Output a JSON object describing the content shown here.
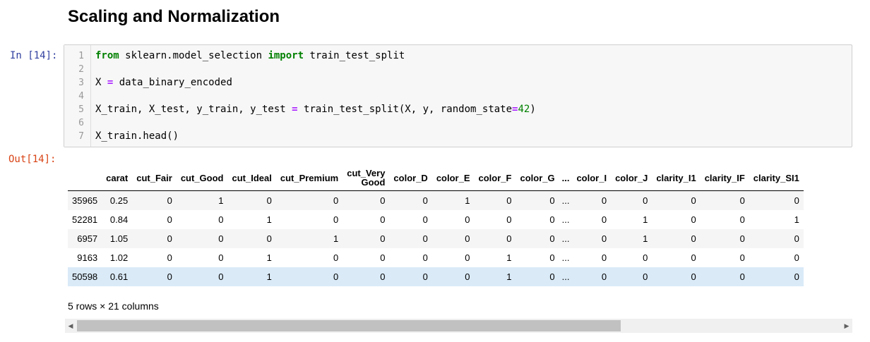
{
  "heading": "Scaling and Normalization",
  "in_prompt": "In [14]:",
  "out_prompt": "Out[14]:",
  "code_lines": [
    {
      "n": "1",
      "tokens": [
        {
          "t": "kw",
          "v": "from"
        },
        {
          "t": "",
          "v": " sklearn.model_selection "
        },
        {
          "t": "kw",
          "v": "import"
        },
        {
          "t": "",
          "v": " train_test_split"
        }
      ]
    },
    {
      "n": "2",
      "tokens": []
    },
    {
      "n": "3",
      "tokens": [
        {
          "t": "",
          "v": "X "
        },
        {
          "t": "op",
          "v": "="
        },
        {
          "t": "",
          "v": " data_binary_encoded"
        }
      ]
    },
    {
      "n": "4",
      "tokens": []
    },
    {
      "n": "5",
      "tokens": [
        {
          "t": "",
          "v": "X_train, X_test, y_train, y_test "
        },
        {
          "t": "op",
          "v": "="
        },
        {
          "t": "",
          "v": " train_test_split(X, y, random_state"
        },
        {
          "t": "op",
          "v": "="
        },
        {
          "t": "num",
          "v": "42"
        },
        {
          "t": "",
          "v": ")"
        }
      ]
    },
    {
      "n": "6",
      "tokens": []
    },
    {
      "n": "7",
      "tokens": [
        {
          "t": "",
          "v": "X_train.head()"
        }
      ]
    }
  ],
  "table": {
    "columns": [
      "carat",
      "cut_Fair",
      "cut_Good",
      "cut_Ideal",
      "cut_Premium",
      "cut_Very Good",
      "color_D",
      "color_E",
      "color_F",
      "color_G",
      "...",
      "color_I",
      "color_J",
      "clarity_I1",
      "clarity_IF",
      "clarity_SI1"
    ],
    "rows": [
      {
        "index": "35965",
        "cells": [
          "0.25",
          "0",
          "1",
          "0",
          "0",
          "0",
          "0",
          "1",
          "0",
          "0",
          "...",
          "0",
          "0",
          "0",
          "0",
          "0"
        ]
      },
      {
        "index": "52281",
        "cells": [
          "0.84",
          "0",
          "0",
          "1",
          "0",
          "0",
          "0",
          "0",
          "0",
          "0",
          "...",
          "0",
          "1",
          "0",
          "0",
          "1"
        ]
      },
      {
        "index": "6957",
        "cells": [
          "1.05",
          "0",
          "0",
          "0",
          "1",
          "0",
          "0",
          "0",
          "0",
          "0",
          "...",
          "0",
          "1",
          "0",
          "0",
          "0"
        ]
      },
      {
        "index": "9163",
        "cells": [
          "1.02",
          "0",
          "0",
          "1",
          "0",
          "0",
          "0",
          "0",
          "1",
          "0",
          "...",
          "0",
          "0",
          "0",
          "0",
          "0"
        ]
      },
      {
        "index": "50598",
        "cells": [
          "0.61",
          "0",
          "0",
          "1",
          "0",
          "0",
          "0",
          "0",
          "1",
          "0",
          "...",
          "0",
          "0",
          "0",
          "0",
          "0"
        ]
      }
    ],
    "highlighted_row": 4
  },
  "summary": "5 rows × 21 columns",
  "scroll": {
    "left_arrow": "◀",
    "right_arrow": "▶"
  }
}
